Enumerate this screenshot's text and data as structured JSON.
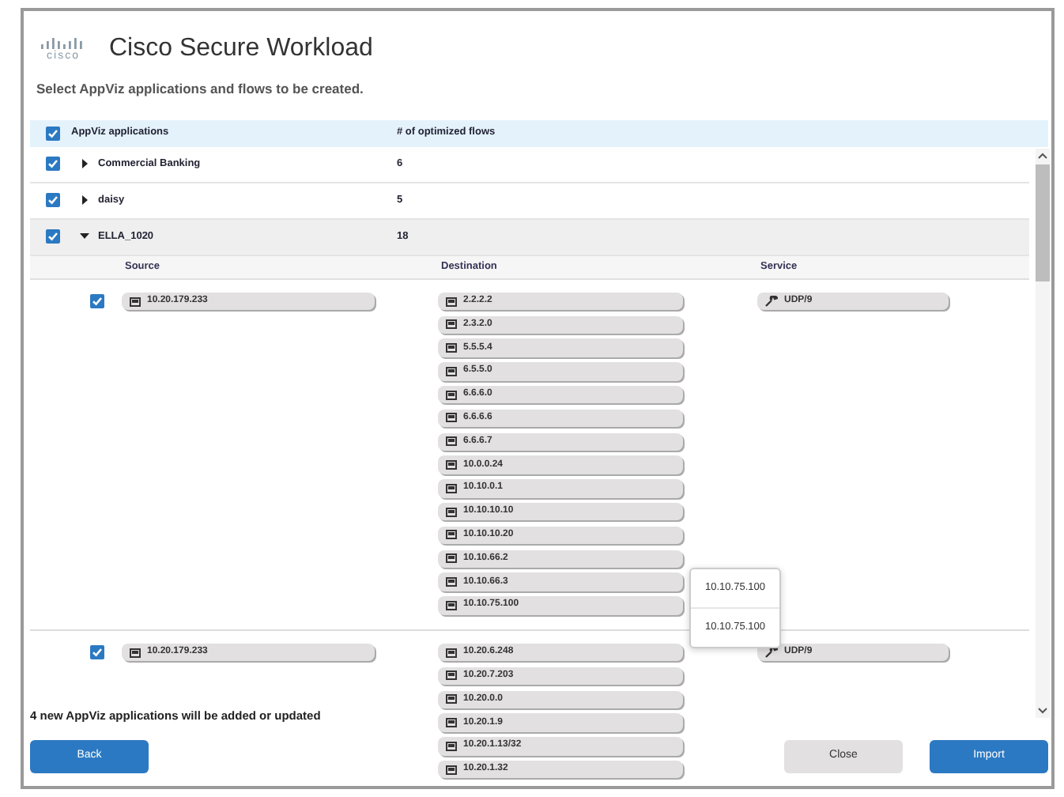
{
  "header": {
    "logo_text": "cisco",
    "title": "Cisco Secure Workload",
    "subtitle": "Select AppViz applications and flows to be created."
  },
  "table": {
    "select_all": {
      "checked": true
    },
    "columns": [
      "AppViz applications",
      "# of optimized flows"
    ],
    "rows": [
      {
        "name": "Commercial Banking",
        "flows": "6",
        "checked": true,
        "expanded": false
      },
      {
        "name": "daisy",
        "flows": "5",
        "checked": true,
        "expanded": false
      },
      {
        "name": "ELLA_1020",
        "flows": "18",
        "checked": true,
        "expanded": true,
        "flow_columns": [
          "Source",
          "Destination",
          "Service"
        ],
        "flow_rows": [
          {
            "checked": true,
            "source": "10.20.179.233",
            "destinations": [
              "2.2.2.2",
              "2.3.2.0",
              "5.5.5.4",
              "6.5.5.0",
              "6.6.6.0",
              "6.6.6.6",
              "6.6.6.7",
              "10.0.0.24",
              "10.10.0.1",
              "10.10.10.10",
              "10.10.10.20",
              "10.10.66.2",
              "10.10.66.3",
              "10.10.75.100"
            ],
            "service": "UDP/9",
            "popup": [
              "10.10.75.100",
              "10.10.75.100"
            ]
          },
          {
            "checked": true,
            "source": "10.20.179.233",
            "destinations": [
              "10.20.6.248",
              "10.20.7.203",
              "10.20.0.0",
              "10.20.1.9",
              "10.20.1.13/32",
              "10.20.1.32"
            ],
            "service": "UDP/9"
          }
        ]
      }
    ]
  },
  "status": "4 new AppViz applications will be added or updated",
  "buttons": [
    {
      "label": "Back",
      "kind": "primary"
    },
    {
      "label": "Close",
      "kind": "secondary"
    },
    {
      "label": "Import",
      "kind": "primary"
    }
  ]
}
